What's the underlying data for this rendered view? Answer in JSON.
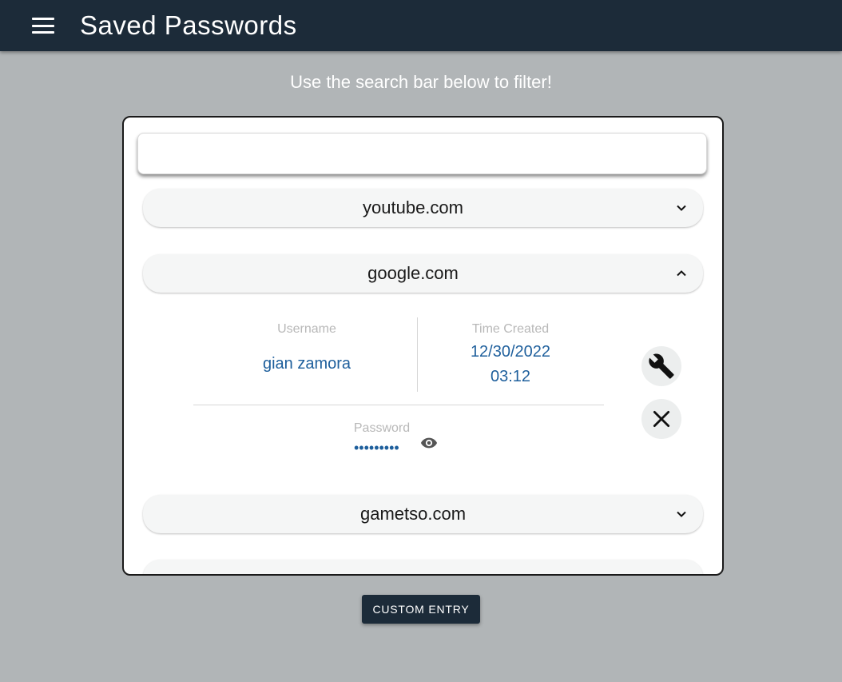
{
  "app": {
    "title": "Saved Passwords",
    "menu_icon": "hamburger-menu-icon"
  },
  "hint": "Use the search bar below to filter!",
  "search": {
    "value": "",
    "placeholder": ""
  },
  "entries": [
    {
      "site": "youtube.com",
      "expanded": false,
      "icon": "chevron-down-icon"
    },
    {
      "site": "google.com",
      "expanded": true,
      "icon": "chevron-up-icon"
    },
    {
      "site": "gametso.com",
      "expanded": false,
      "icon": "chevron-down-icon"
    },
    {
      "site": "",
      "expanded": false,
      "partially_visible": true
    }
  ],
  "details": {
    "username_label": "Username",
    "username": "gian zamora",
    "time_label": "Time Created",
    "date": "12/30/2022",
    "time": "03:12",
    "password_label": "Password",
    "password_masked": "•••••••••",
    "edit_icon": "wrench-icon",
    "delete_icon": "close-icon",
    "reveal_icon": "eye-icon"
  },
  "custom_entry_label": "CUSTOM ENTRY",
  "colors": {
    "appbar": "#1c2b39",
    "background": "#b1b5b7",
    "value_text": "#1e5f9c",
    "label_text": "#b8b8b8"
  }
}
